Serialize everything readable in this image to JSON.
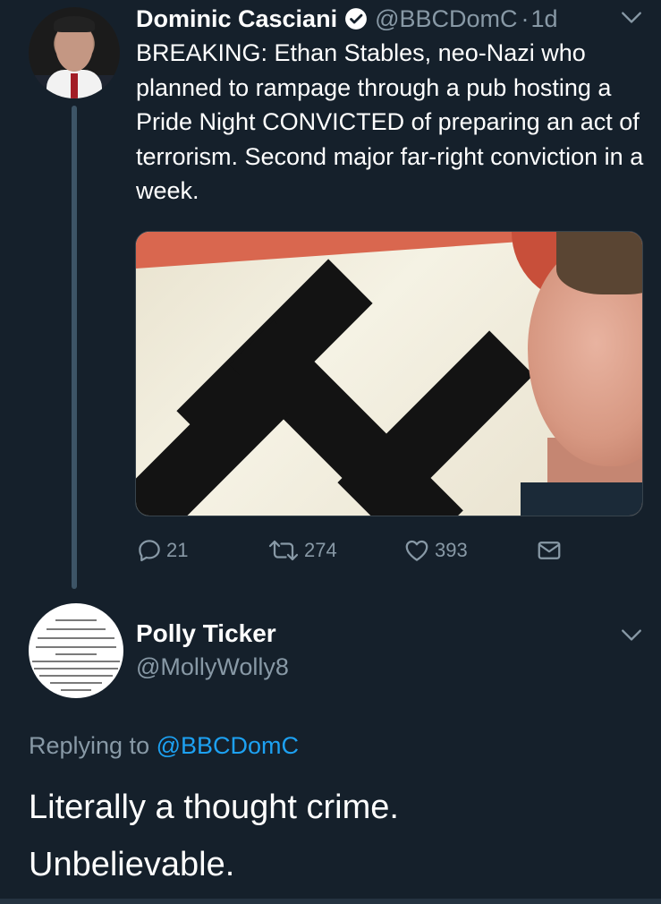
{
  "tweet": {
    "author_name": "Dominic Casciani",
    "author_handle": "@BBCDomC",
    "separator": "·",
    "time": "1d",
    "text": "BREAKING: Ethan Stables, neo-Nazi who planned to rampage through a pub hosting a Pride Night CONVICTED of preparing an act of terrorism. Second major far-right conviction in a week.",
    "reply_count": "21",
    "retweet_count": "274",
    "like_count": "393"
  },
  "reply": {
    "author_name": "Polly Ticker",
    "author_handle": "@MollyWolly8",
    "replying_to_prefix": "Replying to",
    "replying_to_handle": "@BBCDomC",
    "text_line1": "Literally a thought crime.",
    "text_line2": "Unbelievable."
  },
  "icons": {
    "verified": "verified-badge-icon",
    "caret": "chevron-down-icon",
    "reply": "reply-icon",
    "retweet": "retweet-icon",
    "like": "heart-icon",
    "message": "envelope-icon"
  },
  "colors": {
    "background": "#15202b",
    "secondary_text": "#8899a6",
    "link": "#1da1f2",
    "thread_line": "#3d5466"
  }
}
